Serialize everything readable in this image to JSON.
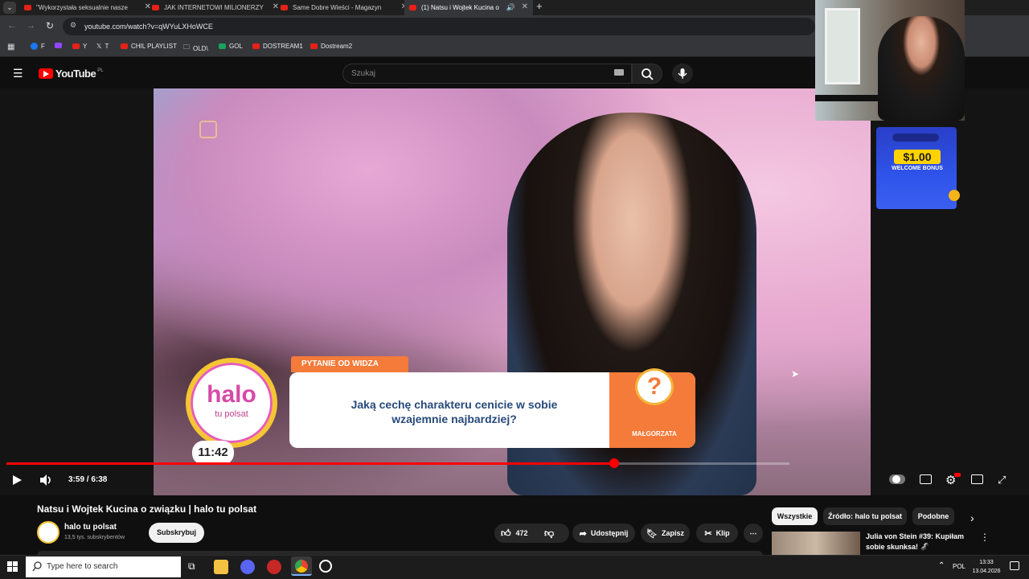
{
  "browser": {
    "tabs": [
      {
        "label": "\"Wykorzystała seksualnie nasze",
        "active": false
      },
      {
        "label": "JAK INTERNETOWI MILIONERZY",
        "active": false
      },
      {
        "label": "Same Dobre Wieści - Magazyn",
        "active": false
      },
      {
        "label": "(1) Natsu i Wojtek Kucina o",
        "active": true
      }
    ],
    "url": "youtube.com/watch?v=qWYuLXHoWCE",
    "bookmarks": [
      "F",
      "",
      "Y",
      "T",
      "CHIL PLAYLIST",
      "OLD\\",
      "GOL",
      "DOSTREAM1",
      "Dostream2"
    ]
  },
  "youtube": {
    "logo": "YouTube",
    "region": "PL",
    "search_placeholder": "Szukaj"
  },
  "video": {
    "caption_tag": "PYTANIE OD WIDZA",
    "caption_line1": "Jaką cechę charakteru cenicie w sobie",
    "caption_line2": "wzajemnie najbardziej?",
    "caption_name": "MAŁGORZATA",
    "caption_symbol": "?",
    "logo_word": "halo",
    "logo_sub": "tu polsat",
    "onscreen_clock": "11:42",
    "time_display": "3:59 / 6:38",
    "progress_fraction": 0.776
  },
  "overlay_ad": {
    "amount": "$1.00",
    "text": "WELCOME BONUS"
  },
  "meta": {
    "title": "Natsu i Wojtek Kucina o związku | halo tu polsat",
    "channel": "halo tu polsat",
    "subscribers": "13,5 tys. subskrybentów",
    "subscribe_label": "Subskrybuj",
    "like_count": "472",
    "share_label": "Udostępnij",
    "save_label": "Zapisz",
    "clip_label": "Klip"
  },
  "recommendations": {
    "chips": [
      "Wszystkie",
      "Źródło: halo tu polsat",
      "Podobne"
    ],
    "first_title": "Julia von Stein #39: Kupiłam sobie skunksa! 🦨"
  },
  "taskbar": {
    "search_placeholder": "Type here to search",
    "language": "POL",
    "time": "13:33",
    "date": "13.04.2026"
  }
}
